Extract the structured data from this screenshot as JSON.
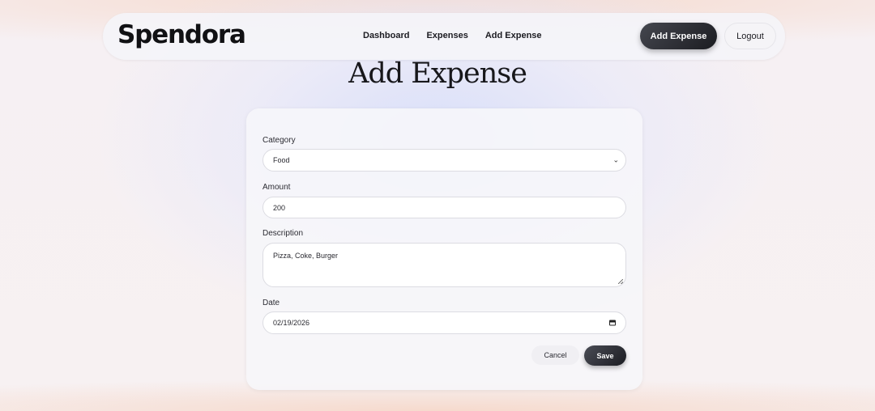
{
  "nav": {
    "brand": "Spendora",
    "links": [
      "Dashboard",
      "Expenses",
      "Add Expense"
    ],
    "add_button": "Add Expense",
    "logout_button": "Logout"
  },
  "page": {
    "title": "Add Expense"
  },
  "form": {
    "category": {
      "label": "Category",
      "value": "Food",
      "icon": "chevron-down-icon"
    },
    "amount": {
      "label": "Amount",
      "value": "200"
    },
    "description": {
      "label": "Description",
      "value": "Pizza, Coke, Burger"
    },
    "date": {
      "label": "Date",
      "value": "02/19/2026",
      "icon": "calendar-icon"
    },
    "cancel_label": "Cancel",
    "save_label": "Save"
  },
  "colors": {
    "primary_button": "#1c1d22",
    "background": "#f7f0f2"
  }
}
